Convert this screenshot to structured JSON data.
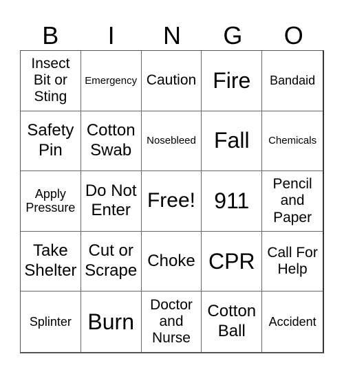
{
  "header": {
    "letters": [
      "B",
      "I",
      "N",
      "G",
      "O"
    ]
  },
  "board": {
    "cells": [
      [
        "Insect Bit or Sting",
        "Emergency",
        "Caution",
        "Fire",
        "Bandaid"
      ],
      [
        "Safety Pin",
        "Cotton Swab",
        "Nosebleed",
        "Fall",
        "Chemicals"
      ],
      [
        "Apply Pressure",
        "Do Not Enter",
        "Free!",
        "911",
        "Pencil and Paper"
      ],
      [
        "Take Shelter",
        "Cut or Scrape",
        "Choke",
        "CPR",
        "Call For Help"
      ],
      [
        "Splinter",
        "Burn",
        "Doctor and Nurse",
        "Cotton Ball",
        "Accident"
      ]
    ],
    "free_space": "Free!"
  }
}
